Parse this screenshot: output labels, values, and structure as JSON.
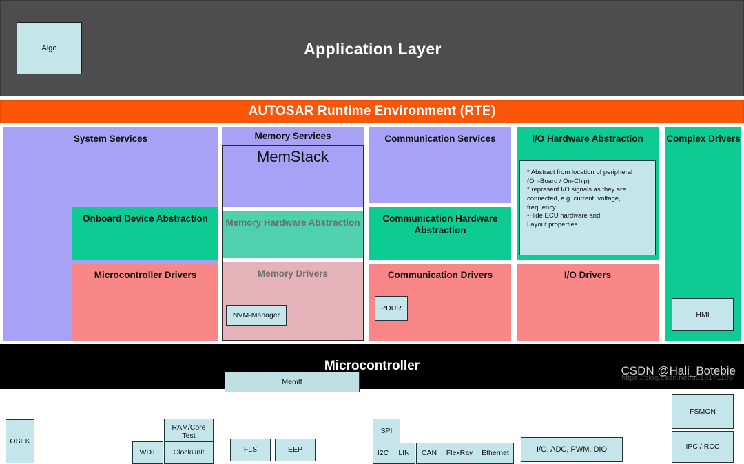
{
  "application_layer": {
    "title": "Application Layer",
    "algo_box": "Algo"
  },
  "rte": {
    "title": "AUTOSAR Runtime Environment (RTE)"
  },
  "columns": {
    "system_services": {
      "title": "System Services",
      "osek": "OSEK",
      "onboard_device_abstraction": "Onboard Device Abstraction",
      "microcontroller_drivers": "Microcontroller Drivers",
      "driver_chips": [
        "RAM/Core Test",
        "WDT",
        "ClockUnit"
      ]
    },
    "memory": {
      "title": "Memory Services",
      "memstack": "MemStack",
      "nvm_manager": "NVM-Manager",
      "memory_hardware_abstraction": "Memory Hardware Abstraction",
      "memif": "MemIf",
      "memory_drivers": "Memory Drivers",
      "driver_chips": [
        "FLS",
        "EEP"
      ]
    },
    "communication": {
      "title": "Communication Services",
      "pdur": "PDUR",
      "hardware_abstraction": "Communication Hardware Abstraction",
      "drivers_title": "Communication Drivers",
      "spi": "SPI",
      "driver_chips": [
        "I2C",
        "LIN",
        "CAN",
        "FlexRay",
        "Ethernet"
      ]
    },
    "io": {
      "title": "I/O Hardware Abstraction",
      "notes": [
        "* Abstract from location of peripheral",
        "   (On-Board / On-Chip)",
        "* represent I/O signals as they are",
        "   connected, e.g. current, voltage,",
        "   frequency",
        "•Hide ECU hardware and",
        "   Layout properties"
      ],
      "drivers_title": "I/O Drivers",
      "drivers_chip": "I/O, ADC, PWM, DIO"
    },
    "complex_drivers": {
      "title": "Complex Drivers",
      "chips": [
        "HMI",
        "FSMON",
        "IPC / RCC"
      ]
    }
  },
  "microcontroller": {
    "title": "Microcontroller"
  },
  "watermark": {
    "text": "CSDN @Hali_Botebie",
    "url": "https://blog.csdn.net/u013171109"
  },
  "colors": {
    "app_layer_bg": "#4d4d4d",
    "rte_orange": "#fb5607",
    "services_purple": "#a7a2f5",
    "abstraction_green": "#0ecb93",
    "drivers_pink": "#fa8787",
    "chip_blue": "#c4e6ea",
    "muted_green": "#4fd2ab",
    "muted_pink": "#e4b2b8",
    "microcontroller_black": "#000000"
  }
}
